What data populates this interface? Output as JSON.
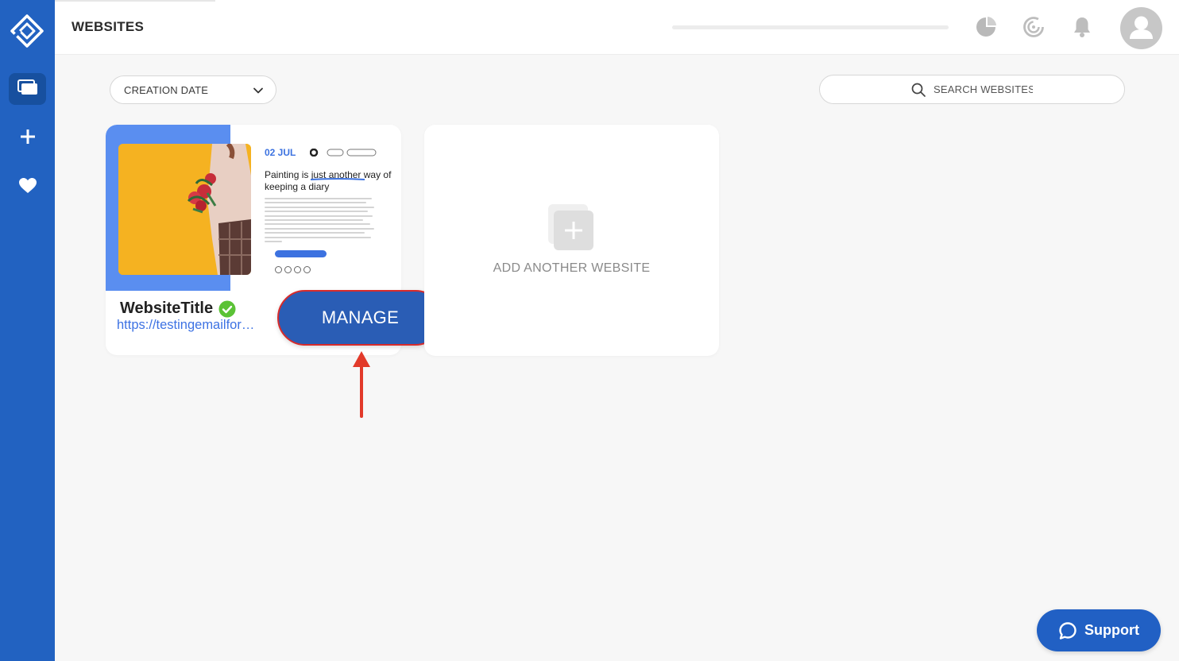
{
  "header": {
    "title": "WEBSITES",
    "progress": 0.0
  },
  "toolbar": {
    "sort_label": "CREATION DATE",
    "search_placeholder": "SEARCH WEBSITES"
  },
  "site_card": {
    "title": "WebsiteTitle",
    "url": "https://testingemailfor…",
    "preview": {
      "date": "02 JUL",
      "headline": "Painting is just another way of keeping a diary"
    },
    "verified": true
  },
  "manage_label": "MANAGE",
  "add_card": {
    "label": "ADD ANOTHER WEBSITE"
  },
  "support_label": "Support",
  "colors": {
    "sidebar": "#2262c1",
    "accent_blue": "#3d72e3",
    "manage_bg": "#2a5db5",
    "annotation_red": "#e23a2a",
    "verified_green": "#5bc236"
  },
  "icons": {
    "logo": "diamond-logo-icon",
    "nav": [
      "websites-icon",
      "plus-icon",
      "heart-icon"
    ],
    "header": [
      "analytics-pie-icon",
      "speed-gauge-icon",
      "bell-icon",
      "user-avatar-icon"
    ]
  }
}
